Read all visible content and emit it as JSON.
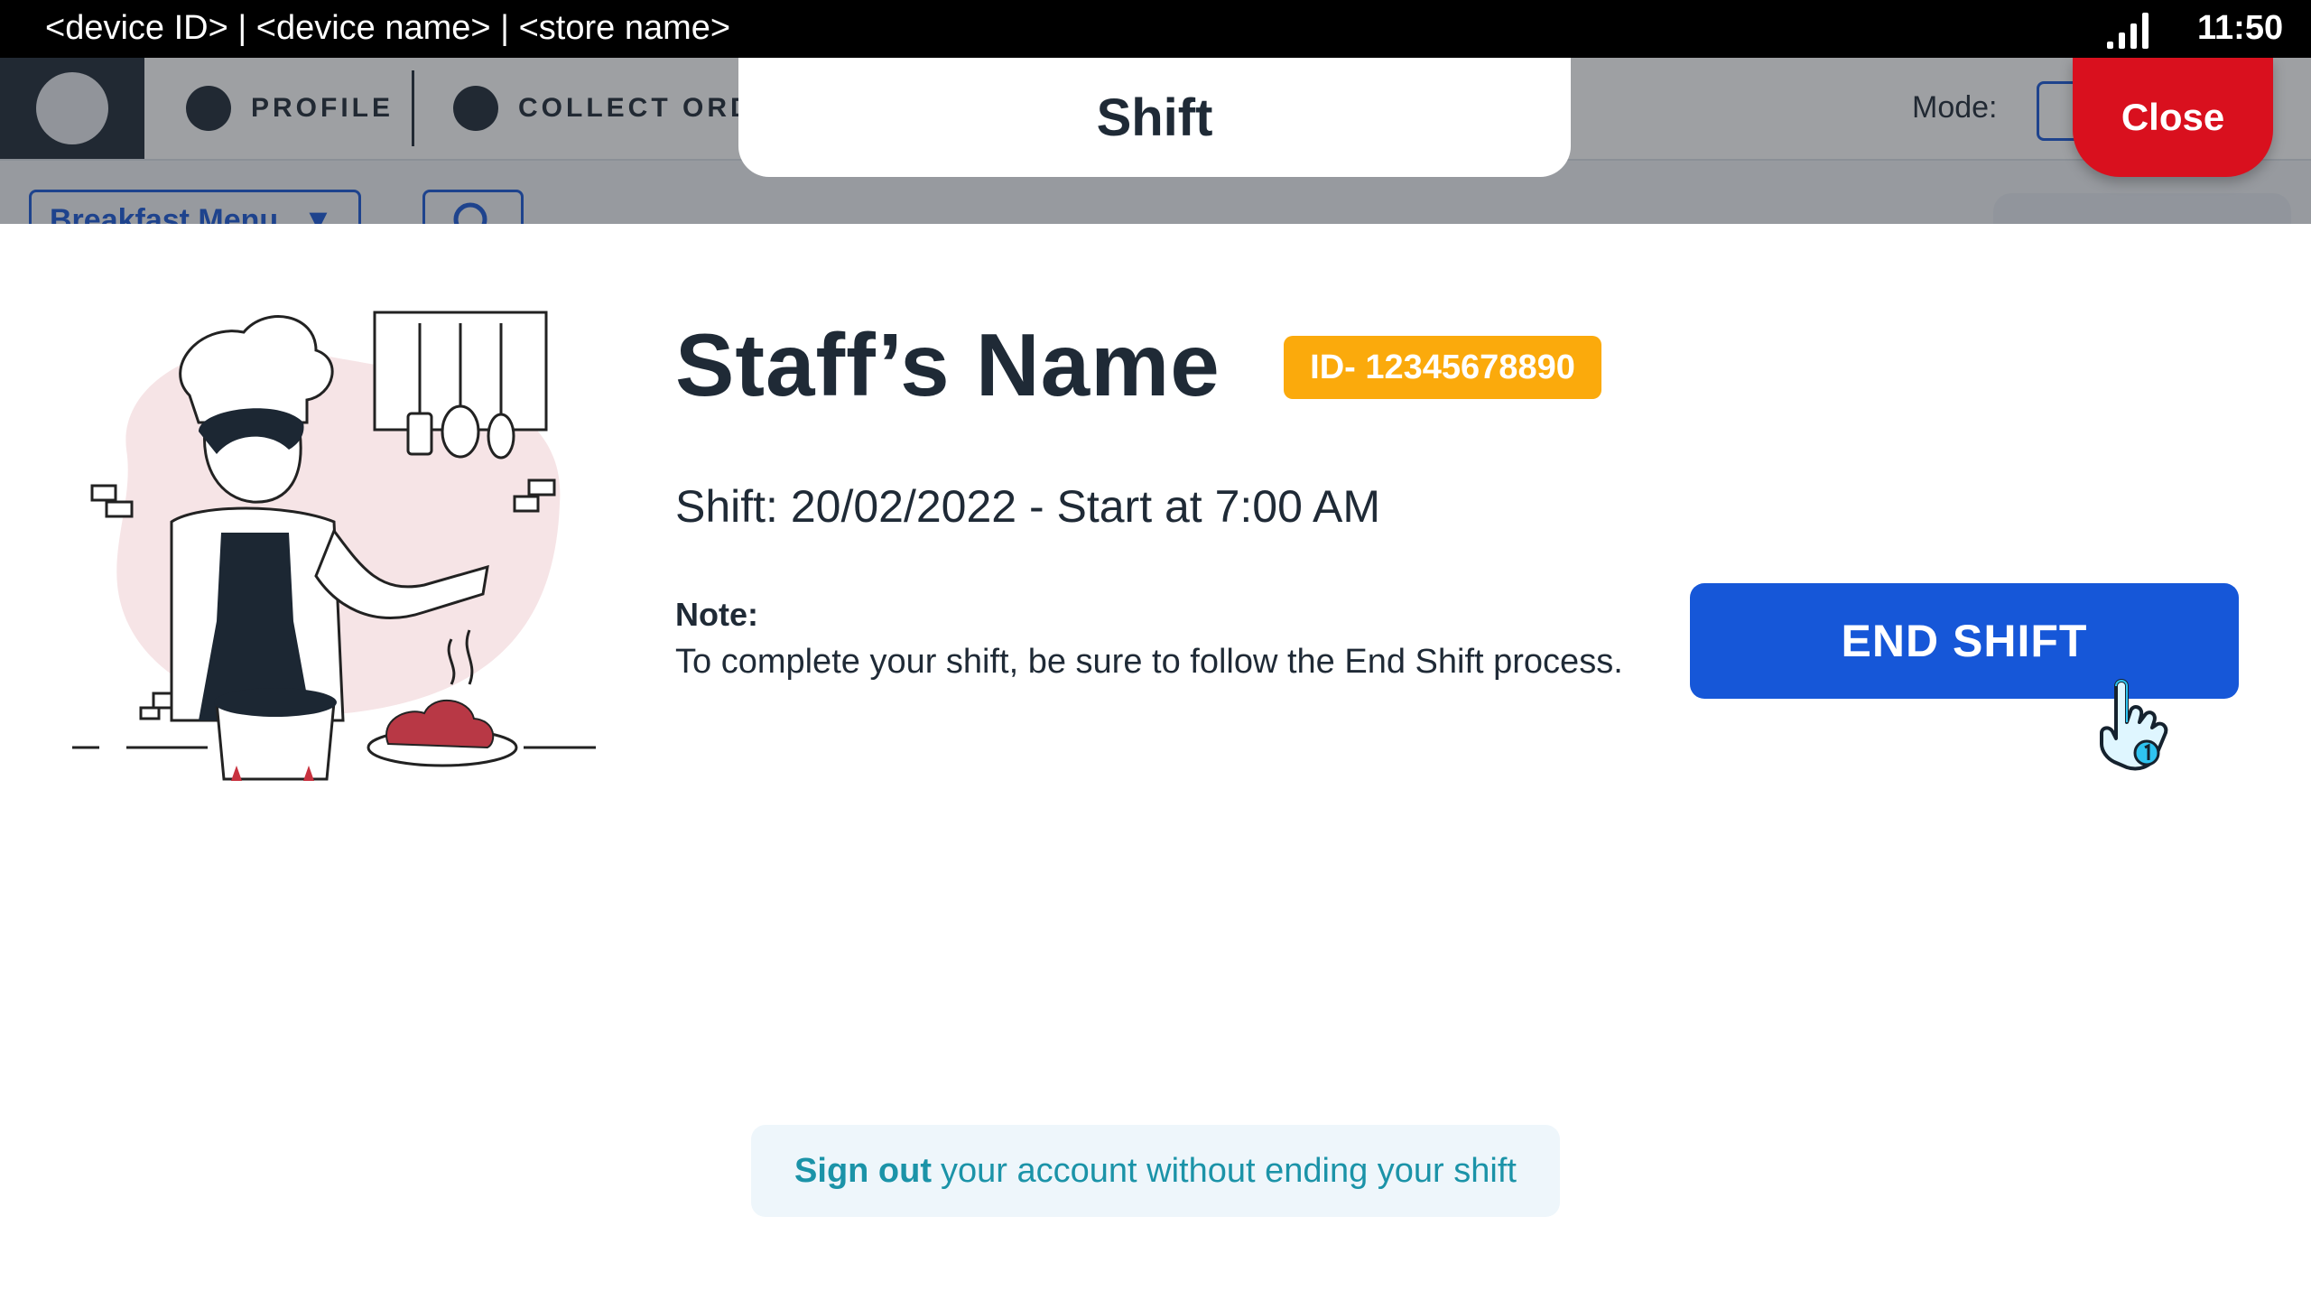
{
  "status_bar": {
    "device_info": "<device ID> | <device name> | <store name>",
    "time": "11:50",
    "signal_icon": "signal-bars-icon"
  },
  "app": {
    "nav": {
      "profile_label": "PROFILE",
      "collect_orders_label": "COLLECT ORDE",
      "mode_label": "Mode:"
    },
    "menu_select_value": "Breakfast Menu",
    "icons": [
      "user-card-icon",
      "profile-icon",
      "restaurant-icon",
      "search-icon",
      "chevron-down-icon"
    ]
  },
  "modal": {
    "title": "Shift",
    "close_label": "Close",
    "staff_name": "Staff’s Name",
    "staff_id": "ID- 12345678890",
    "shift_text": "Shift: 20/02/2022 - Start at 7:00 AM",
    "note_label": "Note:",
    "note_text": "To complete your shift, be sure to follow the End Shift process.",
    "end_shift_label": "END SHIFT",
    "signout_strong": "Sign out",
    "signout_rest": "your account without ending your shift"
  },
  "colors": {
    "primary_blue": "#1657d8",
    "close_red": "#d9101e",
    "badge_orange": "#fbaa0c",
    "signout_teal": "#1b93a8",
    "text_dark": "#1f2a36"
  }
}
